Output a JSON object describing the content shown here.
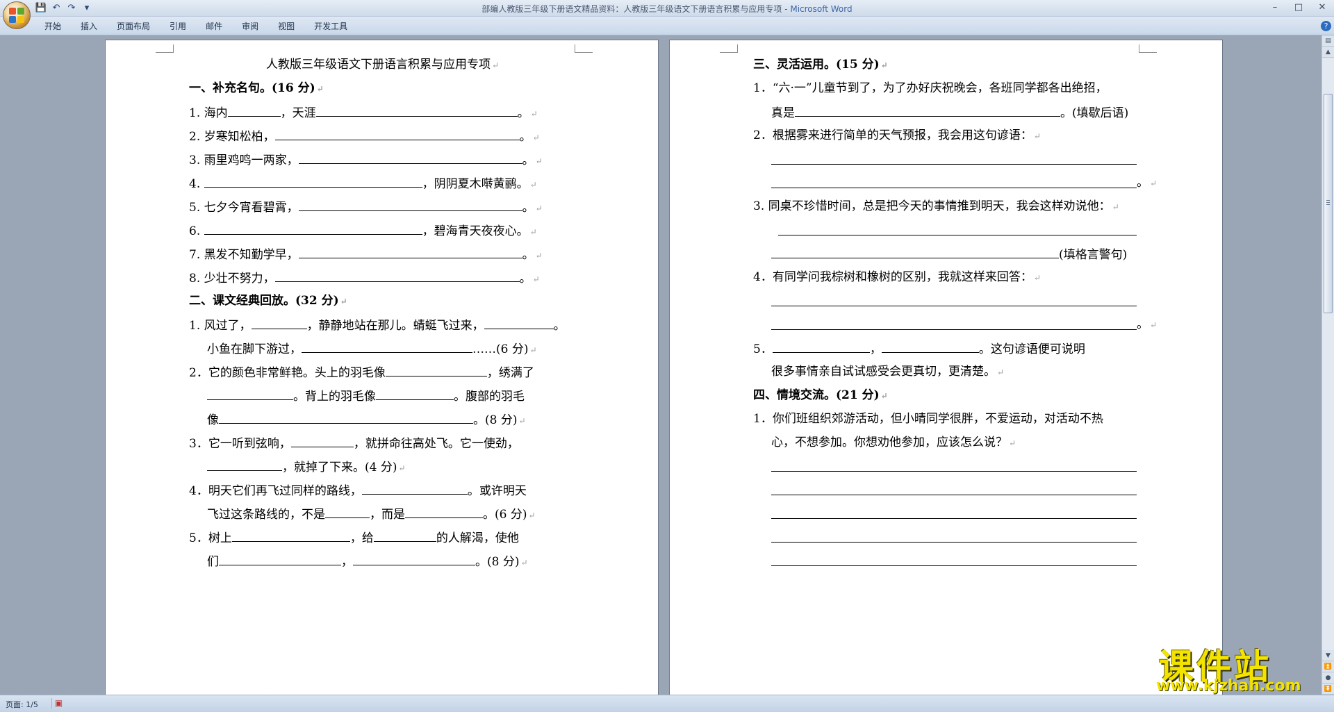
{
  "titlebar": {
    "document": "部编人教版三年级下册语文精品资料：人教版三年级语文下册语言积累与应用专项",
    "separator": " - ",
    "app": "Microsoft Word",
    "qat_save": "💾",
    "qat_undo": "↶",
    "qat_redo": "↷",
    "qat_more": "▾",
    "minimize": "–",
    "maximize": "□",
    "close": "✕"
  },
  "ribbon": {
    "tabs": [
      "开始",
      "插入",
      "页面布局",
      "引用",
      "邮件",
      "审阅",
      "视图",
      "开发工具"
    ],
    "help": "?"
  },
  "left_page": {
    "title": "人教版三年级语文下册语言积累与应用专项",
    "s1": "一、补充名句。(16 分)",
    "q1_1a": "1. 海内",
    "q1_1b": "，天涯",
    "end": "。",
    "q1_2": "2. 岁寒知松柏，",
    "q1_3": "3. 雨里鸡鸣一两家，",
    "q1_4a": "4. ",
    "q1_4b": "，阴阴夏木啭黄鹂。",
    "q1_5": "5. 七夕今宵看碧霄，",
    "q1_6a": "6. ",
    "q1_6b": "，碧海青天夜夜心。",
    "q1_7": "7. 黑发不知勤学早，",
    "q1_8": "8. 少壮不努力，",
    "s2": "二、课文经典回放。(32 分)",
    "q2_1a": "1. 风过了，",
    "q2_1b": "，静静地站在那儿。蜻蜓飞过来，",
    "q2_1c": "。",
    "q2_1d": "小鱼在脚下游过，",
    "q2_1e": "……(6 分)",
    "q2_2a": "2．它的颜色非常鲜艳。头上的羽毛像",
    "q2_2b": "，绣满了",
    "q2_2c": "。背上的羽毛像",
    "q2_2d": "。腹部的羽毛",
    "q2_2e": "像",
    "q2_2f": "。(8 分)",
    "q2_3a": "3．它一听到弦响，",
    "q2_3b": "，就拼命往高处飞。它一使劲，",
    "q2_3c": "，就掉了下来。(4 分)",
    "q2_4a": "4．明天它们再飞过同样的路线，",
    "q2_4b": "。或许明天",
    "q2_4c": "飞过这条路线的，不是",
    "q2_4d": "，而是",
    "q2_4e": "。(6 分)",
    "q2_5a": "5．树上",
    "q2_5b": "，给",
    "q2_5c": "的人解渴，使他",
    "q2_5d": "们",
    "q2_5e": "，",
    "q2_5f": "。(8 分)"
  },
  "right_page": {
    "s3": "三、灵活运用。(15 分)",
    "q3_1a": "1．“六·一”儿童节到了，为了办好庆祝晚会，各班同学都各出绝招，",
    "q3_1b": "真是",
    "q3_1c": "。(填歇后语)",
    "q3_2": "2．根据雾来进行简单的天气预报，我会用这句谚语：",
    "end": "。",
    "q3_3": "3. 同桌不珍惜时间，总是把今天的事情推到明天，我会这样劝说他：",
    "q3_3b": "(填格言警句)",
    "q3_4": "4．有同学问我棕树和橡树的区别，我就这样来回答：",
    "q3_5a": "5．",
    "q3_5b": "，",
    "q3_5c": "。这句谚语便可说明",
    "q3_5d": "很多事情亲自试试感受会更真切，更清楚。",
    "s4": "四、情境交流。(21 分)",
    "q4_1a": "1．你们班组织郊游活动，但小晴同学很胖，不爱运动，对活动不热",
    "q4_1b": "心，不想参加。你想劝他参加，应该怎么说？"
  },
  "status": {
    "page": "页面: 1/5"
  },
  "watermark": {
    "title": "课件站",
    "url": "www.kjzhan.com"
  }
}
